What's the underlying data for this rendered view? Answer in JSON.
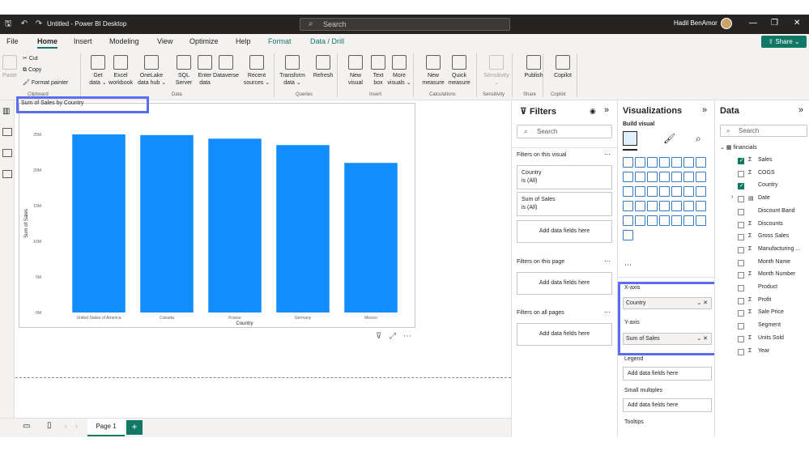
{
  "titlebar": {
    "title": "Untitled - Power BI Desktop",
    "search_placeholder": "Search",
    "user": "Hadil BenAmor"
  },
  "menu": {
    "items": [
      "File",
      "Home",
      "Insert",
      "Modeling",
      "View",
      "Optimize",
      "Help",
      "Format",
      "Data / Drill"
    ],
    "active": "Home",
    "share": "Share"
  },
  "ribbon": {
    "cut": "Cut",
    "copy": "Copy",
    "format_painter": "Format painter",
    "paste": "Paste",
    "buttons": [
      {
        "label": "Get\ndata ⌄",
        "icon": "database-icon"
      },
      {
        "label": "Excel\nworkbook",
        "icon": "excel-icon"
      },
      {
        "label": "OneLake\ndata hub ⌄",
        "icon": "onelake-icon"
      },
      {
        "label": "SQL\nServer",
        "icon": "sql-server-icon"
      },
      {
        "label": "Enter\ndata",
        "icon": "table-icon"
      },
      {
        "label": "Dataverse",
        "icon": "dataverse-icon"
      },
      {
        "label": "Recent\nsources ⌄",
        "icon": "recent-icon"
      },
      {
        "label": "Transform\ndata ⌄",
        "icon": "transform-icon"
      },
      {
        "label": "Refresh",
        "icon": "refresh-icon"
      },
      {
        "label": "New\nvisual",
        "icon": "chart-icon"
      },
      {
        "label": "Text\nbox",
        "icon": "textbox-icon"
      },
      {
        "label": "More\nvisuals ⌄",
        "icon": "visuals-icon"
      },
      {
        "label": "New\nmeasure",
        "icon": "calculator-icon"
      },
      {
        "label": "Quick\nmeasure",
        "icon": "quick-measure-icon"
      },
      {
        "label": "Sensitivity\n⌄",
        "icon": "sensitivity-icon"
      },
      {
        "label": "Publish",
        "icon": "publish-icon"
      },
      {
        "label": "Copilot",
        "icon": "copilot-icon"
      }
    ],
    "groups": [
      "Clipboard",
      "Data",
      "Queries",
      "Insert",
      "Calculations",
      "Sensitivity",
      "Share",
      "Copilot"
    ]
  },
  "visual": {
    "title": "Sum of Sales by Country"
  },
  "chart_data": {
    "type": "bar",
    "title": "Sum of Sales by Country",
    "xlabel": "Country",
    "ylabel": "Sum of Sales",
    "categories": [
      "United States of America",
      "Canada",
      "France",
      "Germany",
      "Mexico"
    ],
    "values": [
      25000000,
      24900000,
      24400000,
      23500000,
      21000000
    ],
    "ylim": [
      0,
      25000000
    ],
    "yticks": [
      "0M",
      "5M",
      "10M",
      "15M",
      "20M",
      "25M"
    ],
    "ytick_values": [
      0,
      5000000,
      10000000,
      15000000,
      20000000,
      25000000
    ],
    "bar_color": "#118dff",
    "grid": false
  },
  "filters": {
    "title": "Filters",
    "search": "Search",
    "on_visual": "Filters on this visual",
    "cards": [
      {
        "field": "Country",
        "state": "is (All)"
      },
      {
        "field": "Sum of Sales",
        "state": "is (All)"
      }
    ],
    "add": "Add data fields here",
    "on_page": "Filters on this page",
    "on_all": "Filters on all pages"
  },
  "visualizations": {
    "title": "Visualizations",
    "build": "Build visual",
    "xaxis": "X-axis",
    "xfield": "Country",
    "yaxis": "Y-axis",
    "yfield": "Sum of Sales",
    "legend": "Legend",
    "small_multiples": "Small multiples",
    "tooltips": "Tooltips",
    "add": "Add data fields here"
  },
  "data": {
    "title": "Data",
    "search": "Search",
    "table": "financials",
    "fields": [
      {
        "name": "Sales",
        "sigma": true,
        "checked": true
      },
      {
        "name": "COGS",
        "sigma": true,
        "checked": false
      },
      {
        "name": "Country",
        "sigma": false,
        "checked": true
      },
      {
        "name": "Date",
        "sigma": false,
        "checked": false,
        "icon": "calendar-icon"
      },
      {
        "name": "Discount Band",
        "sigma": false,
        "checked": false
      },
      {
        "name": "Discounts",
        "sigma": true,
        "checked": false
      },
      {
        "name": "Gross Sales",
        "sigma": true,
        "checked": false
      },
      {
        "name": "Manufacturing ...",
        "sigma": true,
        "checked": false
      },
      {
        "name": "Month Name",
        "sigma": false,
        "checked": false
      },
      {
        "name": "Month Number",
        "sigma": true,
        "checked": false
      },
      {
        "name": "Product",
        "sigma": false,
        "checked": false
      },
      {
        "name": "Profit",
        "sigma": true,
        "checked": false
      },
      {
        "name": "Sale Price",
        "sigma": true,
        "checked": false
      },
      {
        "name": "Segment",
        "sigma": false,
        "checked": false
      },
      {
        "name": "Units Sold",
        "sigma": true,
        "checked": false
      },
      {
        "name": "Year",
        "sigma": true,
        "checked": false
      }
    ]
  },
  "pages": {
    "tab": "Page 1",
    "add": "+"
  }
}
